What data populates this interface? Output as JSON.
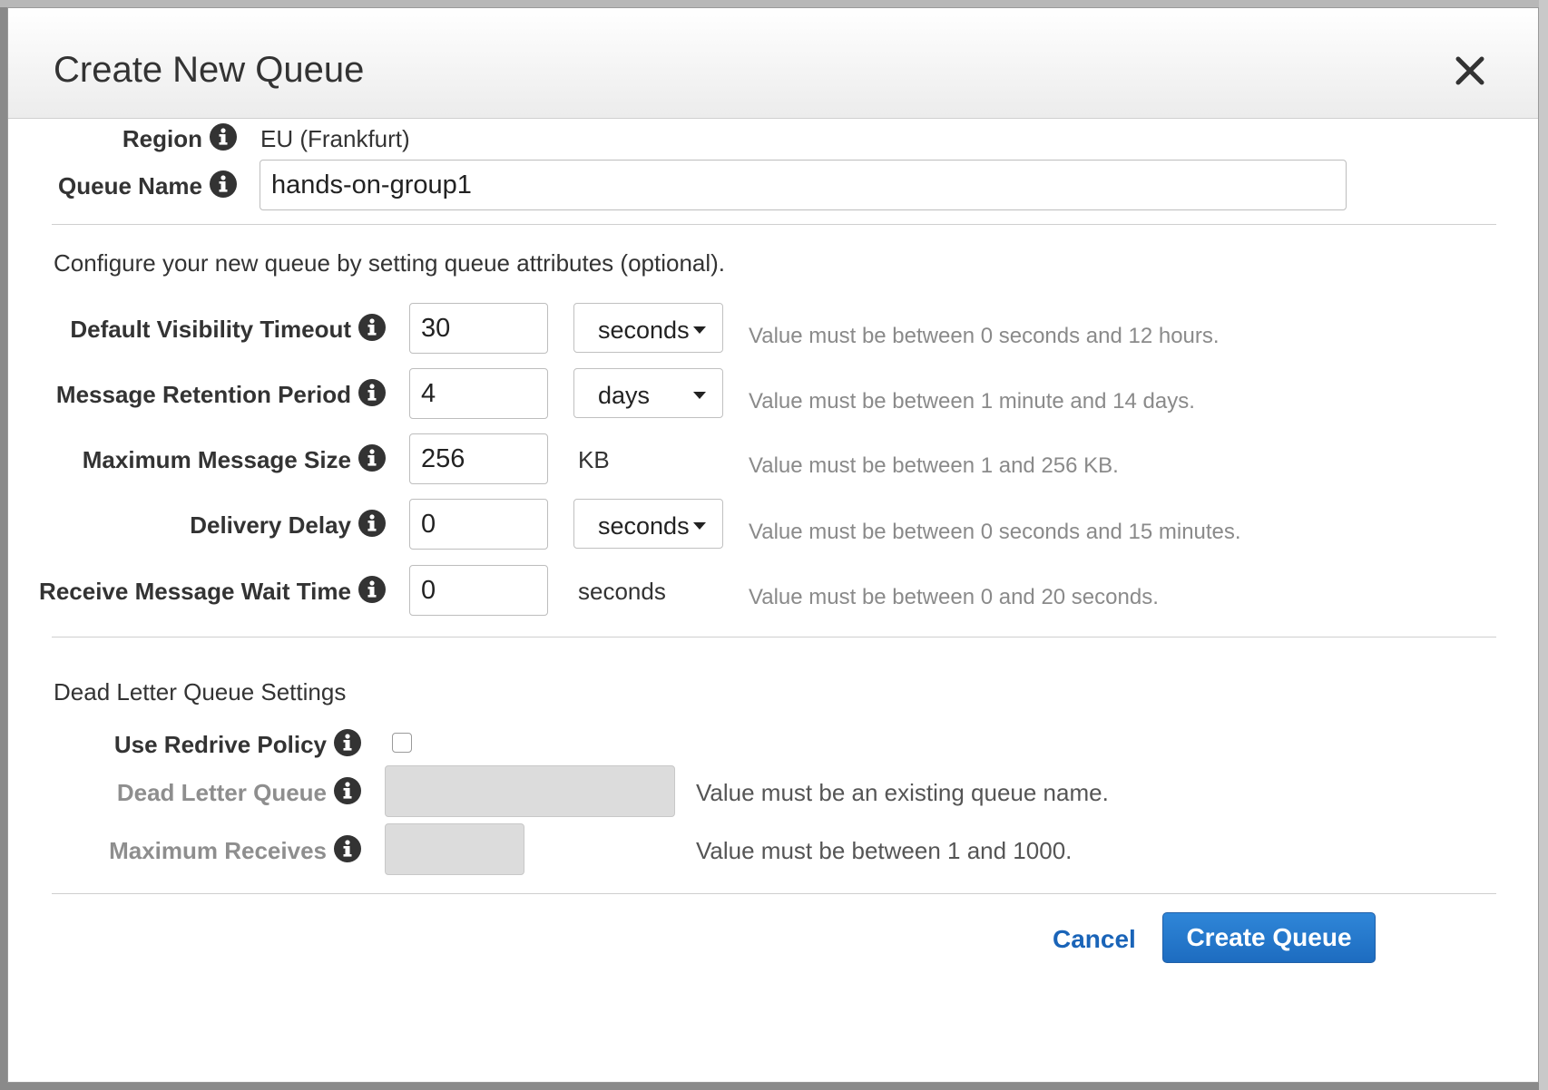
{
  "dialog": {
    "title": "Create New Queue",
    "close_icon": "close-icon"
  },
  "region": {
    "label": "Region",
    "value": "EU (Frankfurt)"
  },
  "queue_name": {
    "label": "Queue Name",
    "value": "hands-on-group1"
  },
  "attributes": {
    "intro": "Configure your new queue by setting queue attributes (optional).",
    "visibility_timeout": {
      "label": "Default Visibility Timeout",
      "value": "30",
      "unit": "seconds",
      "hint": "Value must be between 0 seconds and 12 hours."
    },
    "retention_period": {
      "label": "Message Retention Period",
      "value": "4",
      "unit": "days",
      "hint": "Value must be between 1 minute and 14 days."
    },
    "max_message_size": {
      "label": "Maximum Message Size",
      "value": "256",
      "unit": "KB",
      "hint": "Value must be between 1 and 256 KB."
    },
    "delivery_delay": {
      "label": "Delivery Delay",
      "value": "0",
      "unit": "seconds",
      "hint": "Value must be between 0 seconds and 15 minutes."
    },
    "receive_wait_time": {
      "label": "Receive Message Wait Time",
      "value": "0",
      "unit": "seconds",
      "hint": "Value must be between 0 and 20 seconds."
    }
  },
  "dead_letter": {
    "title": "Dead Letter Queue Settings",
    "use_redrive_policy": {
      "label": "Use Redrive Policy",
      "checked": false
    },
    "dead_letter_queue": {
      "label": "Dead Letter Queue",
      "value": "",
      "hint": "Value must be an existing queue name."
    },
    "max_receives": {
      "label": "Maximum Receives",
      "value": "",
      "hint": "Value must be between 1 and 1000."
    }
  },
  "footer": {
    "cancel_label": "Cancel",
    "create_label": "Create Queue"
  },
  "icons": {
    "info": "info-icon",
    "dropdown": "chevron-down-icon"
  },
  "colors": {
    "primary": "#1d6cc0",
    "link": "#1a64b8",
    "hint": "#8a8a8a"
  }
}
